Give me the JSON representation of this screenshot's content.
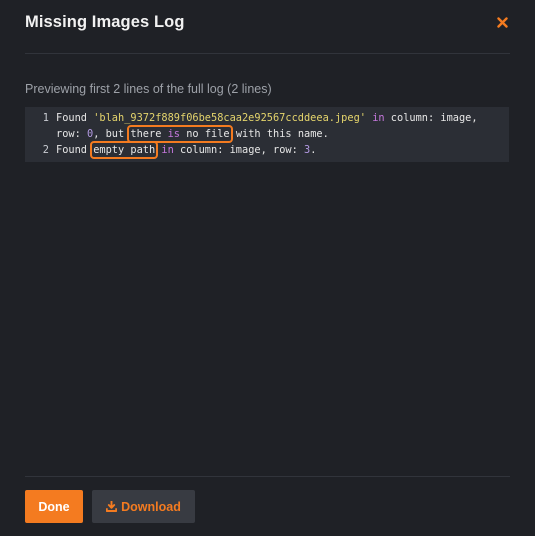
{
  "modal": {
    "title": "Missing Images Log",
    "subtitle": "Previewing first 2 lines of the full log (2 lines)",
    "close_icon": "close-icon"
  },
  "log": {
    "lines": [
      {
        "number": "1",
        "rows": [
          [
            {
              "text": "Found ",
              "kind": "plain"
            },
            {
              "text": "'blah_9372f889f06be58caa2e92567ccddeea.jpeg'",
              "kind": "string"
            },
            {
              "text": " ",
              "kind": "plain"
            },
            {
              "text": "in",
              "kind": "keyword"
            },
            {
              "text": " column: image,",
              "kind": "plain"
            }
          ],
          [
            {
              "text": "row: ",
              "kind": "plain"
            },
            {
              "text": "0",
              "kind": "number"
            },
            {
              "text": ", but ",
              "kind": "plain"
            },
            {
              "text": "there ",
              "kind": "plain",
              "hl": "start"
            },
            {
              "text": "is",
              "kind": "keyword",
              "hl": "mid"
            },
            {
              "text": " no file",
              "kind": "plain",
              "hl": "end"
            },
            {
              "text": " with this name.",
              "kind": "plain"
            }
          ]
        ]
      },
      {
        "number": "2",
        "rows": [
          [
            {
              "text": "Found ",
              "kind": "plain"
            },
            {
              "text": "empty path",
              "kind": "plain",
              "hl": "single"
            },
            {
              "text": " ",
              "kind": "plain"
            },
            {
              "text": "in",
              "kind": "keyword"
            },
            {
              "text": " column: image, row: ",
              "kind": "plain"
            },
            {
              "text": "3",
              "kind": "number"
            },
            {
              "text": ".",
              "kind": "plain"
            }
          ]
        ]
      }
    ]
  },
  "footer": {
    "done_label": "Done",
    "download_label": "Download",
    "download_icon": "download-icon"
  },
  "colors": {
    "accent": "#f47b20",
    "background": "#1f2126",
    "code_background": "#2b2e35",
    "string": "#e4d46c",
    "keyword": "#c678dd",
    "number": "#b39ae3"
  }
}
